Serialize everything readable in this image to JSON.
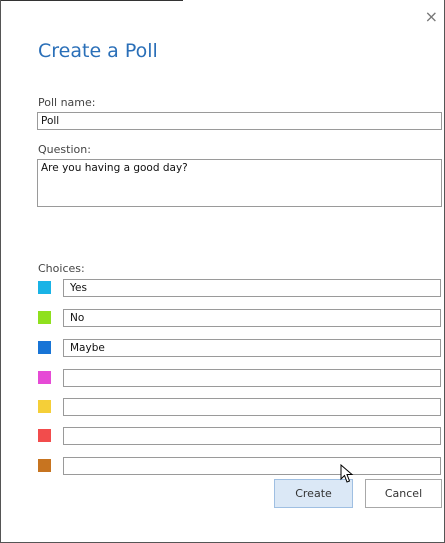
{
  "dialog": {
    "title": "Create a Poll",
    "close_icon": "close-icon"
  },
  "poll_name": {
    "label": "Poll name:",
    "value": "Poll"
  },
  "question": {
    "label": "Question:",
    "value": "Are you having a good day?"
  },
  "choices": {
    "label": "Choices:",
    "items": [
      {
        "value": "Yes",
        "color": "#19b3e6"
      },
      {
        "value": "No",
        "color": "#8fe01e"
      },
      {
        "value": "Maybe",
        "color": "#1874d6"
      },
      {
        "value": "",
        "color": "#e64ad6"
      },
      {
        "value": "",
        "color": "#f5cf38"
      },
      {
        "value": "",
        "color": "#f24c4c"
      },
      {
        "value": "",
        "color": "#c77420"
      }
    ]
  },
  "buttons": {
    "create_label": "Create",
    "cancel_label": "Cancel"
  }
}
